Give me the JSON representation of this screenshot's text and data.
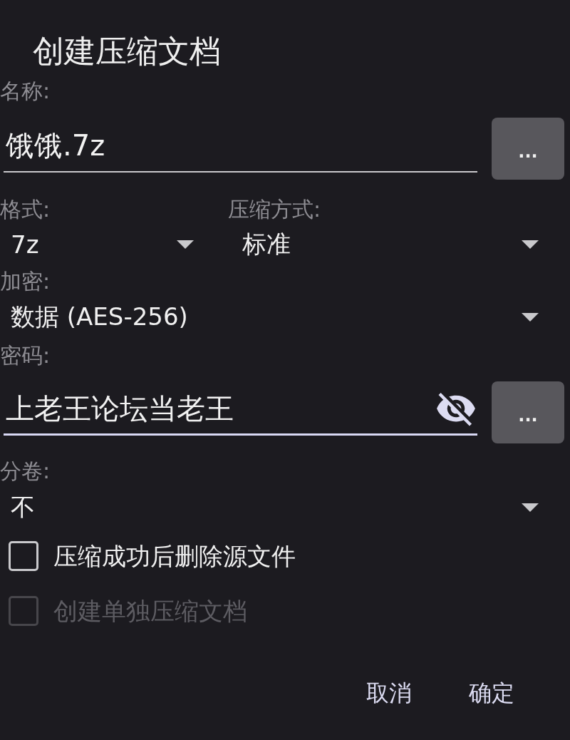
{
  "dialog": {
    "title": "创建压缩文档"
  },
  "name": {
    "label": "名称:",
    "value": "饿饿.7z",
    "focused": false,
    "browse_button": "..."
  },
  "format": {
    "label": "格式:",
    "value": "7z"
  },
  "compression": {
    "label": "压缩方式:",
    "value": "标准"
  },
  "encryption": {
    "label": "加密:",
    "value": "数据 (AES-256)"
  },
  "password": {
    "label": "密码:",
    "value": "上老王论坛当老王",
    "focused": true,
    "visible": true,
    "browse_button": "..."
  },
  "split": {
    "label": "分卷:",
    "value": "不"
  },
  "options": [
    {
      "label": "压缩成功后删除源文件",
      "checked": false,
      "disabled": false
    },
    {
      "label": "创建单独压缩文档",
      "checked": false,
      "disabled": true
    }
  ],
  "buttons": [
    "取消",
    "确定"
  ]
}
